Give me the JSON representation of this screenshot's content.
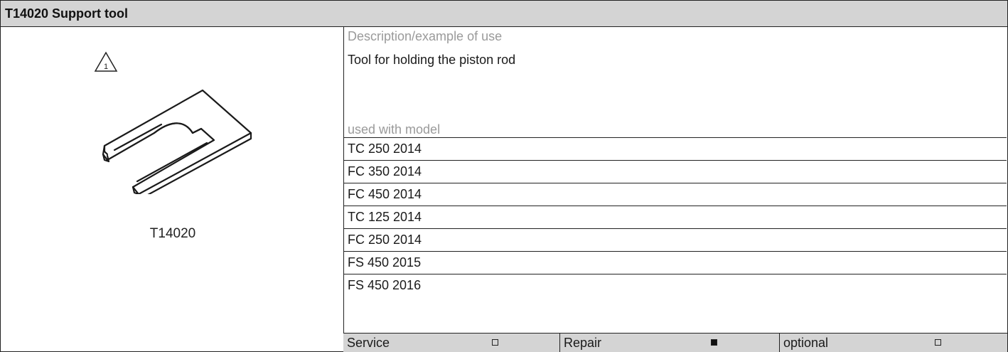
{
  "header": {
    "title": "T14020 Support tool"
  },
  "tool": {
    "number": "T14020",
    "warning_icon_label": "1"
  },
  "description": {
    "label": "Description/example of use",
    "text": "Tool for holding the piston rod"
  },
  "models": {
    "label": "used with model",
    "items": [
      "TC 250 2014",
      "FC 350 2014",
      "FC 450 2014",
      "TC 125 2014",
      "FC 250 2014",
      "FS 450 2015",
      "FS 450 2016"
    ]
  },
  "usage": [
    {
      "label": "Service",
      "checked": false
    },
    {
      "label": "Repair",
      "checked": true
    },
    {
      "label": "optional",
      "checked": false
    }
  ]
}
